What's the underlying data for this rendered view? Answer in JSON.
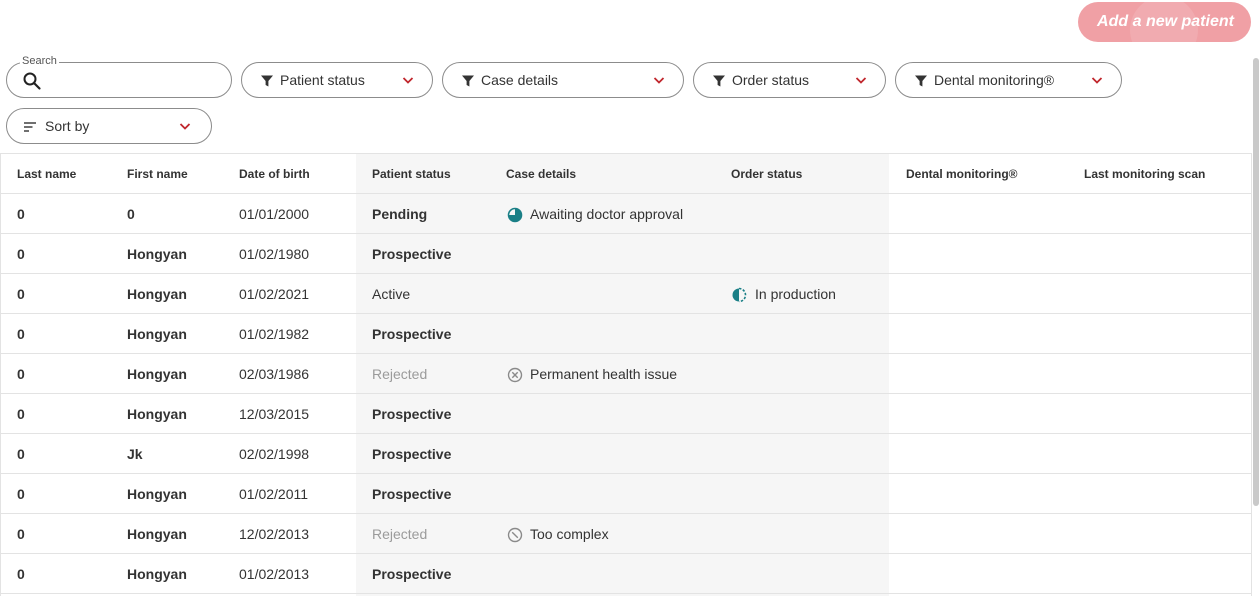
{
  "toolbar": {
    "add_patient_label": "Add a new patient",
    "search_label": "Search",
    "search_value": "",
    "filters": [
      {
        "label": "Patient status"
      },
      {
        "label": "Case details"
      },
      {
        "label": "Order status"
      },
      {
        "label": "Dental monitoring®"
      }
    ],
    "sort_label": "Sort by"
  },
  "table": {
    "headers": [
      "Last name",
      "First name",
      "Date of birth",
      "Patient status",
      "Case details",
      "Order status",
      "Dental monitoring®",
      "Last monitoring scan"
    ],
    "rows": [
      {
        "last": "0",
        "first": "0",
        "dob": "01/01/2000",
        "status": "Pending",
        "case": "Awaiting doctor approval",
        "case_icon": "pie-clock-icon",
        "order": "",
        "order_icon": ""
      },
      {
        "last": "0",
        "first": "Hongyan",
        "dob": "01/02/1980",
        "status": "Prospective",
        "case": "",
        "case_icon": "",
        "order": "",
        "order_icon": ""
      },
      {
        "last": "0",
        "first": "Hongyan",
        "dob": "01/02/2021",
        "status": "Active",
        "case": "",
        "case_icon": "",
        "order": "In production",
        "order_icon": "half-circle-icon"
      },
      {
        "last": "0",
        "first": "Hongyan",
        "dob": "01/02/1982",
        "status": "Prospective",
        "case": "",
        "case_icon": "",
        "order": "",
        "order_icon": ""
      },
      {
        "last": "0",
        "first": "Hongyan",
        "dob": "02/03/1986",
        "status": "Rejected",
        "case": "Permanent health issue",
        "case_icon": "x-circle-icon",
        "order": "",
        "order_icon": ""
      },
      {
        "last": "0",
        "first": "Hongyan",
        "dob": "12/03/2015",
        "status": "Prospective",
        "case": "",
        "case_icon": "",
        "order": "",
        "order_icon": ""
      },
      {
        "last": "0",
        "first": "Jk",
        "dob": "02/02/1998",
        "status": "Prospective",
        "case": "",
        "case_icon": "",
        "order": "",
        "order_icon": ""
      },
      {
        "last": "0",
        "first": "Hongyan",
        "dob": "01/02/2011",
        "status": "Prospective",
        "case": "",
        "case_icon": "",
        "order": "",
        "order_icon": ""
      },
      {
        "last": "0",
        "first": "Hongyan",
        "dob": "12/02/2013",
        "status": "Rejected",
        "case": "Too complex",
        "case_icon": "slash-circle-icon",
        "order": "",
        "order_icon": ""
      },
      {
        "last": "0",
        "first": "Hongyan",
        "dob": "01/02/2013",
        "status": "Prospective",
        "case": "",
        "case_icon": "",
        "order": "",
        "order_icon": ""
      }
    ]
  },
  "colors": {
    "accent": "#f0a0a5",
    "chevron": "#c0272d",
    "teal": "#1a7f86",
    "muted": "#9b9b9b"
  }
}
